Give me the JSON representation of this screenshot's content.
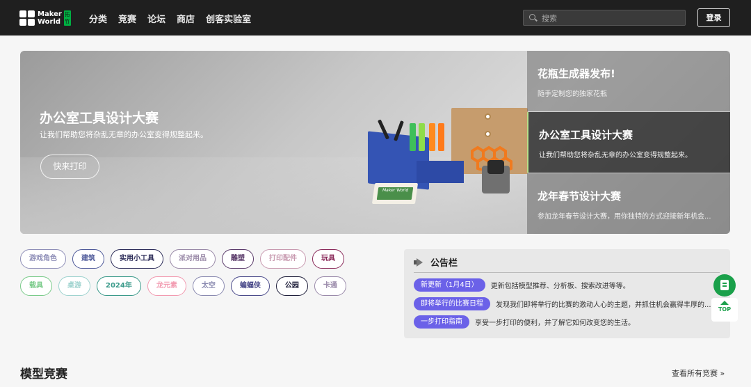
{
  "header": {
    "logo_line1": "Maker",
    "logo_line2": "World",
    "logo_badge": "拓竹",
    "nav": [
      "分类",
      "竞赛",
      "论坛",
      "商店",
      "创客实验室"
    ],
    "search_placeholder": "搜索",
    "login_label": "登录"
  },
  "hero": {
    "title": "办公室工具设计大赛",
    "subtitle": "让我们帮助您将杂乱无章的办公室变得规整起来。",
    "button_label": "快来打印",
    "sign_text": "Maker World",
    "side_items": [
      {
        "title": "花瓶生成器发布!",
        "subtitle": "随手定制您的独家花瓶"
      },
      {
        "title": "办公室工具设计大赛",
        "subtitle": "让我们帮助您将杂乱无章的办公室变得规整起来。"
      },
      {
        "title": "龙年春节设计大赛",
        "subtitle": "参加龙年春节设计大赛，用你独特的方式迎接新年机会..."
      }
    ]
  },
  "categories": {
    "row1": [
      {
        "label": "游戏角色",
        "color": "#8f8fb8"
      },
      {
        "label": "建筑",
        "color": "#4f5a9a"
      },
      {
        "label": "实用小工具",
        "color": "#2e2e5a"
      },
      {
        "label": "派对用品",
        "color": "#9a8aa8"
      },
      {
        "label": "雕塑",
        "color": "#5a3a6a"
      },
      {
        "label": "打印配件",
        "color": "#c89ab0"
      },
      {
        "label": "玩具",
        "color": "#8a2a5a"
      }
    ],
    "row2": [
      {
        "label": "载具",
        "color": "#7acb8a"
      },
      {
        "label": "桌游",
        "color": "#9fd3cf"
      },
      {
        "label": "2024年",
        "color": "#3a9a8a"
      },
      {
        "label": "龙元素",
        "color": "#f29ab0"
      },
      {
        "label": "太空",
        "color": "#8a8ab0"
      },
      {
        "label": "蝙蝠侠",
        "color": "#4a4a8a"
      },
      {
        "label": "公园",
        "color": "#1e1e3a"
      },
      {
        "label": "卡通",
        "color": "#9a8aaa"
      }
    ]
  },
  "notice": {
    "title": "公告栏",
    "items": [
      {
        "tag": "新更新（1月4日）",
        "text": "更新包括模型推荐、分析板、搜索改进等等。"
      },
      {
        "tag": "即将举行的比赛日程",
        "text": "发现我们即将举行的比赛的激动人心的主题，并抓住机会赢得丰厚的..."
      },
      {
        "tag": "一步打印指南",
        "text": "享受一步打印的便利，并了解它如何改变您的生活。"
      }
    ]
  },
  "floating": {
    "top_label": "TOP"
  },
  "section": {
    "title": "模型竞赛",
    "see_all": "查看所有竞赛 »"
  }
}
